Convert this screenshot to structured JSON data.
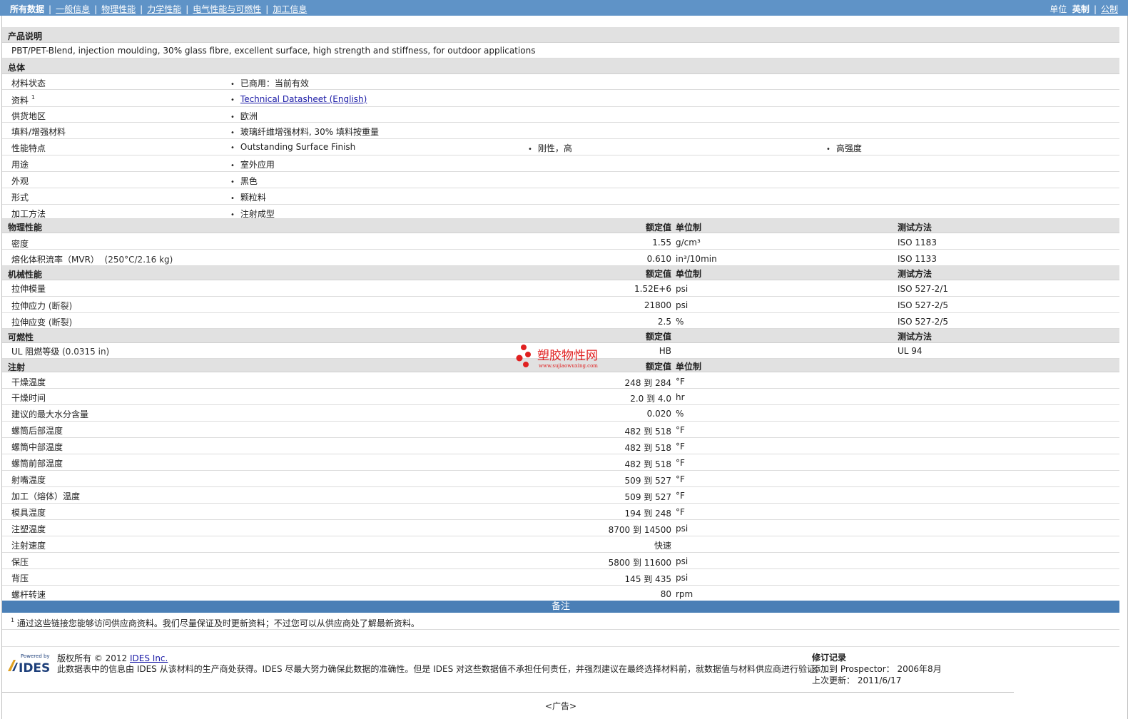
{
  "nav": {
    "tabs": [
      {
        "label": "所有数据"
      },
      {
        "label": "一般信息"
      },
      {
        "label": "物理性能"
      },
      {
        "label": "力学性能"
      },
      {
        "label": "电气性能与可燃性"
      },
      {
        "label": "加工信息"
      }
    ],
    "unit_label": "单位",
    "units": [
      {
        "label": "英制"
      },
      {
        "label": "公制"
      }
    ]
  },
  "description": {
    "header": "产品说明",
    "text": "PBT/PET-Blend, injection moulding, 30% glass fibre, excellent surface, high strength and stiffness, for outdoor applications"
  },
  "general": {
    "header": "总体",
    "rows": [
      {
        "label": "材料状态",
        "items": [
          "已商用：当前有效"
        ]
      },
      {
        "label": "资料",
        "sup": "1",
        "items": [
          "Technical Datasheet (English)"
        ]
      },
      {
        "label": "供货地区",
        "items": [
          "欧洲"
        ]
      },
      {
        "label": "填料/增强材料",
        "items": [
          "玻璃纤维增强材料, 30% 填料按重量"
        ]
      },
      {
        "label": "性能特点",
        "items": [
          "Outstanding Surface Finish",
          "刚性，高",
          "高强度"
        ]
      },
      {
        "label": "用途",
        "items": [
          "室外应用"
        ]
      },
      {
        "label": "外观",
        "items": [
          "黑色"
        ]
      },
      {
        "label": "形式",
        "items": [
          "颗粒料"
        ]
      },
      {
        "label": "加工方法",
        "items": [
          "注射成型"
        ]
      }
    ]
  },
  "physical": {
    "header": "物理性能",
    "col_val": "额定值",
    "col_unit": "单位制",
    "col_test": "测试方法",
    "rows": [
      {
        "label": "密度",
        "cond": "",
        "value": "1.55",
        "unit": "g/cm³",
        "test": "ISO 1183"
      },
      {
        "label": "熔化体积流率（MVR）",
        "cond": "(250°C/2.16 kg)",
        "value": "0.610",
        "unit": "in³/10min",
        "test": "ISO 1133"
      }
    ]
  },
  "mechanical": {
    "header": "机械性能",
    "col_val": "额定值",
    "col_unit": "单位制",
    "col_test": "测试方法",
    "rows": [
      {
        "label": "拉伸模量",
        "cond": "",
        "value": "1.52E+6",
        "unit": "psi",
        "test": "ISO 527-2/1"
      },
      {
        "label": "拉伸应力",
        "cond": "(断裂)",
        "value": "21800",
        "unit": "psi",
        "test": "ISO 527-2/5"
      },
      {
        "label": "拉伸应变",
        "cond": "(断裂)",
        "value": "2.5",
        "unit": "%",
        "test": "ISO 527-2/5"
      }
    ]
  },
  "flammability": {
    "header": "可燃性",
    "col_val": "额定值",
    "col_test": "测试方法",
    "rows": [
      {
        "label": "UL 阻燃等级",
        "cond": "(0.0315 in)",
        "value": "HB",
        "unit": "",
        "test": "UL 94"
      }
    ]
  },
  "injection": {
    "header": "注射",
    "col_val": "额定值",
    "col_unit": "单位制",
    "rows": [
      {
        "label": "干燥温度",
        "value": "248 到  284",
        "unit": "°F"
      },
      {
        "label": "干燥时间",
        "value": "2.0 到  4.0",
        "unit": "hr"
      },
      {
        "label": "建议的最大水分含量",
        "value": "0.020",
        "unit": "%"
      },
      {
        "label": "螺筒后部温度",
        "value": "482 到  518",
        "unit": "°F"
      },
      {
        "label": "螺筒中部温度",
        "value": "482 到  518",
        "unit": "°F"
      },
      {
        "label": "螺筒前部温度",
        "value": "482 到  518",
        "unit": "°F"
      },
      {
        "label": "射嘴温度",
        "value": "509 到  527",
        "unit": "°F"
      },
      {
        "label": "加工（熔体）温度",
        "value": "509 到  527",
        "unit": "°F"
      },
      {
        "label": "模具温度",
        "value": "194 到  248",
        "unit": "°F"
      },
      {
        "label": "注塑温度",
        "value": "8700 到  14500",
        "unit": "psi"
      },
      {
        "label": "注射速度",
        "value": "快速",
        "unit": ""
      },
      {
        "label": "保压",
        "value": "5800 到  11600",
        "unit": "psi"
      },
      {
        "label": "背压",
        "value": "145 到  435",
        "unit": "psi"
      },
      {
        "label": "螺杆转速",
        "value": "80",
        "unit": "rpm"
      }
    ]
  },
  "notes": {
    "header": "备注",
    "footnote_num": "1",
    "footnote": "通过这些链接您能够访问供应商资料。我们尽量保证及时更新资料；不过您可以从供应商处了解最新资料。"
  },
  "footer": {
    "logo_top": "Powered by",
    "logo_text": "IDES",
    "copyright_prefix": "版权所有 © 2012 ",
    "copyright_link": "IDES Inc.",
    "disclaimer": "此数据表中的信息由 IDES 从该材料的生产商处获得。IDES 尽最大努力确保此数据的准确性。但是 IDES 对这些数据值不承担任何责任，并强烈建议在最终选择材料前，就数据值与材料供应商进行验证。",
    "rev_title": "修订记录",
    "added_label": "添加到 Prospector：",
    "added_value": "2006年8月",
    "updated_label": "上次更新：",
    "updated_value": "2011/6/17",
    "ad": "<广告>"
  },
  "watermark": {
    "text": "塑胶物性网",
    "url": "www.sujiaowuxing.com",
    "color": "#e02020"
  }
}
